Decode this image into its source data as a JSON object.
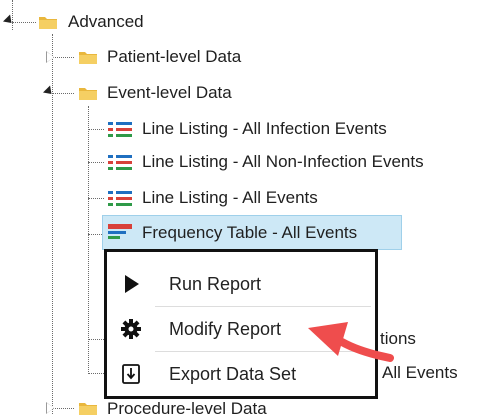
{
  "tree": {
    "advanced": {
      "label": "Advanced"
    },
    "patient_level": {
      "label": "Patient-level Data"
    },
    "event_level": {
      "label": "Event-level Data"
    },
    "reports": [
      {
        "label": "Line Listing - All Infection Events",
        "icon": "line-listing-icon"
      },
      {
        "label": "Line Listing - All Non-Infection Events",
        "icon": "line-listing-icon"
      },
      {
        "label": "Line Listing - All Events",
        "icon": "line-listing-icon"
      },
      {
        "label": "Frequency Table - All Events",
        "icon": "frequency-table-icon",
        "selected": true
      }
    ],
    "partial_hidden": [
      {
        "label": "tions"
      },
      {
        "label": "All Events"
      }
    ],
    "procedure_level": {
      "label": "Procedure-level Data"
    }
  },
  "context_menu": {
    "items": [
      {
        "label": "Run Report",
        "icon": "play-icon"
      },
      {
        "label": "Modify Report",
        "icon": "gear-icon"
      },
      {
        "label": "Export Data Set",
        "icon": "export-icon"
      }
    ]
  },
  "colors": {
    "folder": "#f0c24a",
    "selection": "#cde8f6",
    "arrow": "#ef4d4d",
    "list_blue": "#1f6fc0",
    "list_red": "#d8413a",
    "list_green": "#2f9a48"
  }
}
